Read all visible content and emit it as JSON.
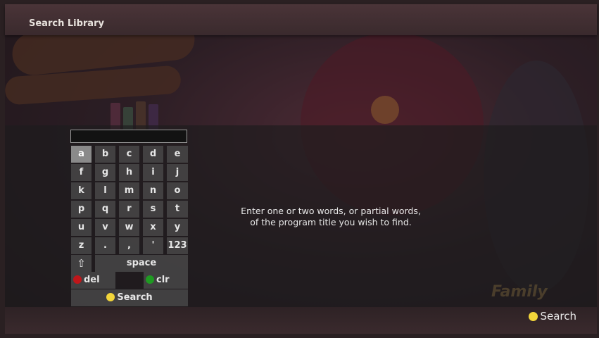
{
  "header": {
    "title": "Search Library"
  },
  "search": {
    "query": ""
  },
  "keyboard": {
    "rows": [
      [
        "a",
        "b",
        "c",
        "d",
        "e"
      ],
      [
        "f",
        "g",
        "h",
        "i",
        "j"
      ],
      [
        "k",
        "l",
        "m",
        "n",
        "o"
      ],
      [
        "p",
        "q",
        "r",
        "s",
        "t"
      ],
      [
        "u",
        "v",
        "w",
        "x",
        "y"
      ],
      [
        "z",
        ".",
        ",",
        "'",
        "123"
      ]
    ],
    "shift_symbol": "⇧",
    "space_label": "space",
    "del_label": "del",
    "clr_label": "clr",
    "search_label": "Search",
    "selected_key": "a"
  },
  "instructions": {
    "line1": "Enter one or two words, or partial words,",
    "line2": "of the program title you wish to find."
  },
  "footer": {
    "search_hint": "Search"
  },
  "watermark": {
    "text": "Family"
  },
  "colors": {
    "red": "#c0161a",
    "green": "#1f9a22",
    "yellow": "#f2d53a"
  }
}
